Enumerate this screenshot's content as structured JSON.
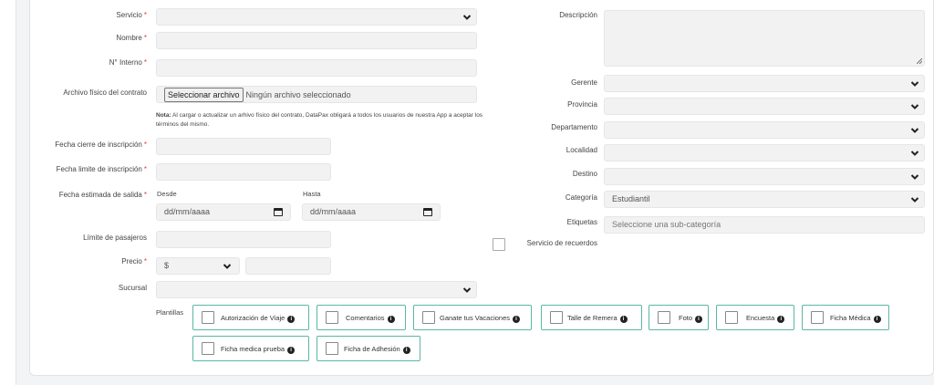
{
  "form": {
    "servicio": {
      "label": "Servicio",
      "required": "*"
    },
    "nombre": {
      "label": "Nombre",
      "required": "*"
    },
    "interno": {
      "label": "N° Interno",
      "required": "*"
    },
    "archivo": {
      "label": "Archivo físico del contrato",
      "button": "Seleccionar archivo",
      "status": "Ningún archivo seleccionado"
    },
    "nota": {
      "bold": "Nota:",
      "text": " Al cargar o actualizar un arhivo físico del contrato, DataPax obligará a todos los usuarios de nuestra App a aceptar los términos del mismo."
    },
    "cierre": {
      "label": "Fecha cierre de inscripción",
      "required": "*"
    },
    "limite": {
      "label": "Fecha limite de inscripción",
      "required": "*"
    },
    "salida": {
      "label": "Fecha estimada de salida",
      "required": "*",
      "desde": "Desde",
      "hasta": "Hasta",
      "desde_value": "dd/mm/aaaa",
      "hasta_value": "dd/mm/aaaa"
    },
    "pasajeros": {
      "label": "Límite de pasajeros"
    },
    "precio": {
      "label": "Precio",
      "required": "*",
      "currency": "$"
    },
    "sucursal": {
      "label": "Sucursal"
    },
    "plantillas": {
      "label": "Plantillas"
    },
    "descripcion": {
      "label": "Descripción"
    },
    "gerente": {
      "label": "Gerente"
    },
    "provincia": {
      "label": "Provincia"
    },
    "departamento": {
      "label": "Departamento"
    },
    "localidad": {
      "label": "Localidad"
    },
    "destino": {
      "label": "Destino"
    },
    "categoria": {
      "label": "Categoría",
      "value": "Estudiantil"
    },
    "etiquetas": {
      "label": "Etiquetas",
      "placeholder": "Seleccione una sub-categoría"
    },
    "recuerdos": {
      "label": "Servicio de recuerdos"
    }
  },
  "templates": [
    {
      "label": "Autorización de Viaje"
    },
    {
      "label": "Comentarios"
    },
    {
      "label": "Ganate tus Vacaciones"
    },
    {
      "label": "Talle de Remera"
    },
    {
      "label": "Foto"
    },
    {
      "label": "Encuesta"
    },
    {
      "label": "Ficha Médica"
    },
    {
      "label": "Ficha medica prueba"
    },
    {
      "label": "Ficha de Adhesión"
    }
  ],
  "icons": {
    "select": "chevron-down-icon",
    "date": "calendar-icon",
    "info": "info-icon"
  },
  "colors": {
    "accent": "#5bb7a4",
    "required": "#e04040",
    "field": "#f2f2f2"
  }
}
